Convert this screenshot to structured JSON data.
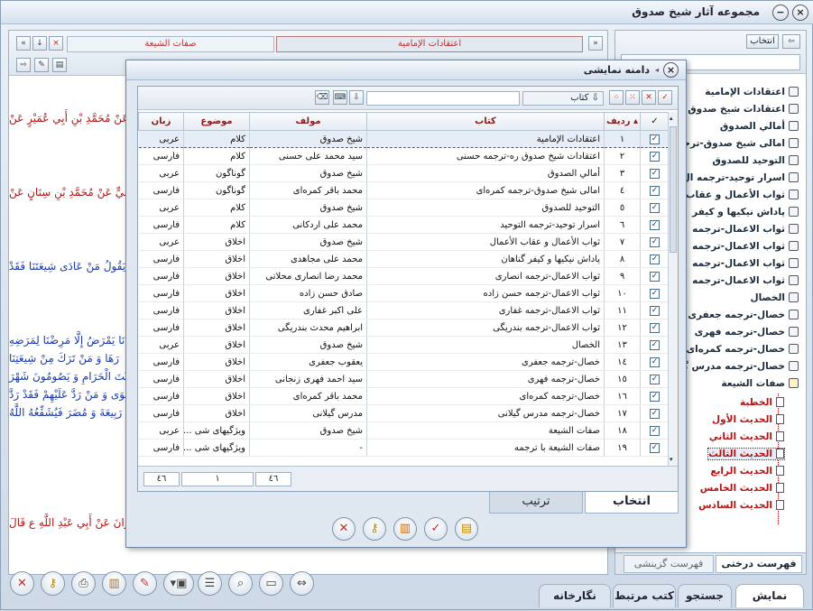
{
  "window": {
    "title": "مجموعه آثار شیخ صدوق"
  },
  "left_pane": {
    "tab_active": "اعتقادات الإمامية",
    "tab_inactive": "صفات الشيعة",
    "lines": [
      "عَنْ مُحَمَّدِ بْنِ أَبِي عُمَيْرٍ عَنْ",
      "فِيٍّ عَنْ مُحَمَّدِ بْنِ سِنَانٍ عَنْ",
      "يَقُولُ مَنْ عَادَى شِيعَتَنَا فَقَدْ",
      "نَا يَمْرَضُ إِلَّا مَرِضْنَا لِمَرَضِهِ",
      "رَهَا وَ مَنْ تَرَكَ مِنْ شِيعَتِنَا",
      "بَيْتَ الْحَرَامِ وَ يَصُومُونَ شَهْرَ",
      "قُوَى وَ مَنْ رَدَّ عَلَيْهِمْ فَقَدْ رَدَّ",
      "رَبِيعَةَ وَ مُضَرَ فَيُشَفِّعُهُ اللَّهُ",
      "رَانَ عَنْ أَبِي عَبْدِ اللَّهِ ع قَالَ"
    ]
  },
  "right_pane": {
    "select_button": "انتخاب",
    "tree": [
      {
        "label": "اعتقادات الإمامية",
        "type": "book"
      },
      {
        "label": "اعتقادات شیخ صدوق",
        "type": "book"
      },
      {
        "label": "أمالي الصدوق",
        "type": "book"
      },
      {
        "label": "امالی شیخ صدوق-ترجمه",
        "type": "book"
      },
      {
        "label": "التوحيد للصدوق",
        "type": "book"
      },
      {
        "label": "اسرار توحید-ترجمه ال",
        "type": "book"
      },
      {
        "label": "ثواب الأعمال و عقاب ا",
        "type": "book"
      },
      {
        "label": "پاداش نيكيها و كيفر",
        "type": "book"
      },
      {
        "label": "ثواب الاعمال-ترجمه",
        "type": "book"
      },
      {
        "label": "ثواب الاعمال-ترجمه",
        "type": "book"
      },
      {
        "label": "ثواب الاعمال-ترجمه",
        "type": "book"
      },
      {
        "label": "ثواب الاعمال-ترجمه",
        "type": "book"
      },
      {
        "label": "الخصال",
        "type": "book"
      },
      {
        "label": "خصال-ترجمه جعفری",
        "type": "book"
      },
      {
        "label": "خصال-ترجمه فهری",
        "type": "book"
      },
      {
        "label": "خصال-ترجمه کمره‌ای",
        "type": "book"
      },
      {
        "label": "خصال-ترجمه مدرس گ",
        "type": "book"
      },
      {
        "label": "صفات الشيعة",
        "type": "book-open"
      },
      {
        "label": "الخطبة",
        "type": "page"
      },
      {
        "label": "الحديث الأول",
        "type": "page"
      },
      {
        "label": "الحديث الثاني",
        "type": "page"
      },
      {
        "label": "الحديث الثالث",
        "type": "page"
      },
      {
        "label": "الحديث الرابع",
        "type": "page"
      },
      {
        "label": "الحديث الخامس",
        "type": "page"
      },
      {
        "label": "الحديث السادس",
        "type": "page"
      }
    ],
    "tabs": [
      "فهرست درختی",
      "فهرست گزینشی"
    ]
  },
  "bottom_tabs": [
    "نمایش",
    "جستجو",
    "كتب مرتبط",
    "نگارخانه"
  ],
  "dialog": {
    "title": "دامنه نمایشی",
    "columns": {
      "check": "✓",
      "row": "ردیف",
      "book": "کتاب",
      "author": "مولف",
      "subject": "موضوع",
      "language": "زبان"
    },
    "filter_label": "کتاب",
    "rows": [
      {
        "n": "۱",
        "book": "اعتقادات الإمامية",
        "author": "شيخ صدوق",
        "subject": "كلام",
        "lang": "عربی"
      },
      {
        "n": "۲",
        "book": "اعتقادات شيخ صدوق ره-ترجمه حسنى",
        "author": "سيد محمد على حسنى",
        "subject": "كلام",
        "lang": "فارسی"
      },
      {
        "n": "۳",
        "book": "أمالي الصدوق",
        "author": "شيخ صدوق",
        "subject": "گوناگون",
        "lang": "عربی"
      },
      {
        "n": "٤",
        "book": "امالی شیخ صدوق-ترجمه كمره‌ای",
        "author": "محمد باقر كمره‌ای",
        "subject": "گوناگون",
        "lang": "فارسی"
      },
      {
        "n": "٥",
        "book": "التوحيد للصدوق",
        "author": "شيخ صدوق",
        "subject": "كلام",
        "lang": "عربی"
      },
      {
        "n": "٦",
        "book": "اسرار توحيد-ترجمه التوحيد",
        "author": "محمد على اردكانى",
        "subject": "كلام",
        "lang": "فارسی"
      },
      {
        "n": "٧",
        "book": "ثواب الأعمال و عقاب الأعمال",
        "author": "شيخ صدوق",
        "subject": "اخلاق",
        "lang": "عربی"
      },
      {
        "n": "۸",
        "book": "پاداش نيكيها و كيفر گناهان",
        "author": "محمد على مجاهدى",
        "subject": "اخلاق",
        "lang": "فارسی"
      },
      {
        "n": "۹",
        "book": "ثواب الاعمال-ترجمه انصارى",
        "author": "محمد رضا انصارى محلاتى",
        "subject": "اخلاق",
        "lang": "فارسی"
      },
      {
        "n": "۱۰",
        "book": "ثواب الاعمال-ترجمه حسن زاده",
        "author": "صادق حسن زاده",
        "subject": "اخلاق",
        "lang": "فارسی"
      },
      {
        "n": "۱۱",
        "book": "ثواب الاعمال-ترجمه غفارى",
        "author": "على اكبر غفارى",
        "subject": "اخلاق",
        "lang": "فارسی"
      },
      {
        "n": "۱۲",
        "book": "ثواب الاعمال-ترجمه بندريگى",
        "author": "ابراهيم محدث بندريگى",
        "subject": "اخلاق",
        "lang": "فارسی"
      },
      {
        "n": "۱۳",
        "book": "الخصال",
        "author": "شيخ صدوق",
        "subject": "اخلاق",
        "lang": "عربی"
      },
      {
        "n": "۱٤",
        "book": "خصال-ترجمه جعفرى",
        "author": "يعقوب جعفرى",
        "subject": "اخلاق",
        "lang": "فارسی"
      },
      {
        "n": "۱٥",
        "book": "خصال-ترجمه فهرى",
        "author": "سيد احمد فهرى زنجانى",
        "subject": "اخلاق",
        "lang": "فارسی"
      },
      {
        "n": "۱٦",
        "book": "خصال-ترجمه كمره‌اى",
        "author": "محمد باقر كمره‌اى",
        "subject": "اخلاق",
        "lang": "فارسی"
      },
      {
        "n": "۱٧",
        "book": "خصال-ترجمه مدرس گيلانى",
        "author": "مدرس گيلانى",
        "subject": "اخلاق",
        "lang": "فارسی"
      },
      {
        "n": "۱۸",
        "book": "صفات الشيعة",
        "author": "شيخ صدوق",
        "subject": "ويژگيهای شی ...",
        "lang": "عربی"
      },
      {
        "n": "۱۹",
        "book": "صفات الشيعة با ترجمه",
        "author": "-",
        "subject": "ويژگيهای شی ...",
        "lang": "فارسی"
      }
    ],
    "pager": {
      "total": "٤٦",
      "current": "١",
      "last": "٤٦"
    },
    "tabs": {
      "select": "انتخاب",
      "sort": "ترتیب"
    }
  }
}
